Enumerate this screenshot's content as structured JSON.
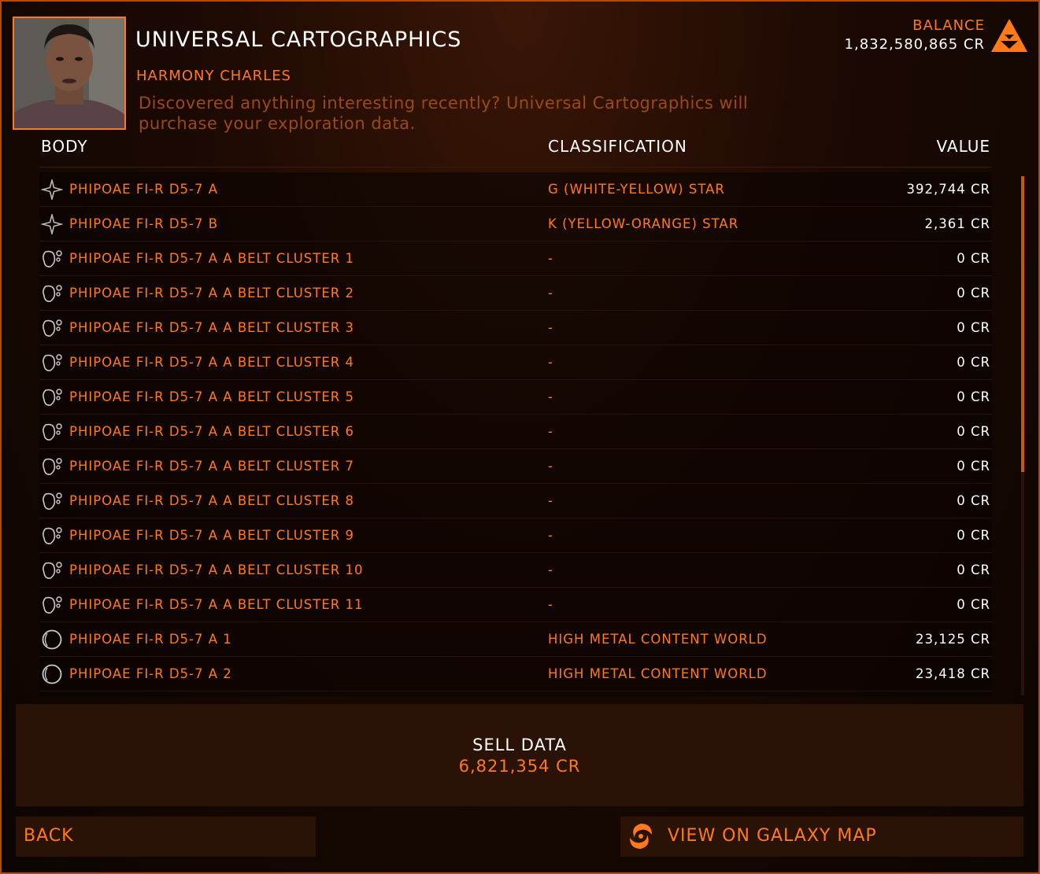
{
  "header": {
    "title": "UNIVERSAL CARTOGRAPHICS",
    "contact": "HARMONY CHARLES",
    "description": "Discovered anything interesting recently? Universal Cartographics will purchase your exploration data.",
    "balance_label": "BALANCE",
    "balance_value": "1,832,580,865 CR"
  },
  "columns": {
    "body": "BODY",
    "classification": "CLASSIFICATION",
    "value": "VALUE"
  },
  "rows": [
    {
      "icon": "star-icon",
      "body": "PHIPOAE FI-R D5-7 A",
      "classification": "G (WHITE-YELLOW) STAR",
      "value": "392,744 CR"
    },
    {
      "icon": "star-icon",
      "body": "PHIPOAE FI-R D5-7 B",
      "classification": "K (YELLOW-ORANGE) STAR",
      "value": "2,361 CR"
    },
    {
      "icon": "asteroid-icon",
      "body": "PHIPOAE FI-R D5-7 A A BELT CLUSTER 1",
      "classification": "-",
      "value": "0 CR"
    },
    {
      "icon": "asteroid-icon",
      "body": "PHIPOAE FI-R D5-7 A A BELT CLUSTER 2",
      "classification": "-",
      "value": "0 CR"
    },
    {
      "icon": "asteroid-icon",
      "body": "PHIPOAE FI-R D5-7 A A BELT CLUSTER 3",
      "classification": "-",
      "value": "0 CR"
    },
    {
      "icon": "asteroid-icon",
      "body": "PHIPOAE FI-R D5-7 A A BELT CLUSTER 4",
      "classification": "-",
      "value": "0 CR"
    },
    {
      "icon": "asteroid-icon",
      "body": "PHIPOAE FI-R D5-7 A A BELT CLUSTER 5",
      "classification": "-",
      "value": "0 CR"
    },
    {
      "icon": "asteroid-icon",
      "body": "PHIPOAE FI-R D5-7 A A BELT CLUSTER 6",
      "classification": "-",
      "value": "0 CR"
    },
    {
      "icon": "asteroid-icon",
      "body": "PHIPOAE FI-R D5-7 A A BELT CLUSTER 7",
      "classification": "-",
      "value": "0 CR"
    },
    {
      "icon": "asteroid-icon",
      "body": "PHIPOAE FI-R D5-7 A A BELT CLUSTER 8",
      "classification": "-",
      "value": "0 CR"
    },
    {
      "icon": "asteroid-icon",
      "body": "PHIPOAE FI-R D5-7 A A BELT CLUSTER 9",
      "classification": "-",
      "value": "0 CR"
    },
    {
      "icon": "asteroid-icon",
      "body": "PHIPOAE FI-R D5-7 A A BELT CLUSTER 10",
      "classification": "-",
      "value": "0 CR"
    },
    {
      "icon": "asteroid-icon",
      "body": "PHIPOAE FI-R D5-7 A A BELT CLUSTER 11",
      "classification": "-",
      "value": "0 CR"
    },
    {
      "icon": "planet-icon",
      "body": "PHIPOAE FI-R D5-7 A 1",
      "classification": "HIGH METAL CONTENT WORLD",
      "value": "23,125 CR"
    },
    {
      "icon": "planet-icon",
      "body": "PHIPOAE FI-R D5-7 A 2",
      "classification": "HIGH METAL CONTENT WORLD",
      "value": "23,418 CR"
    },
    {
      "icon": "planet-icon",
      "body": "",
      "classification": "",
      "value": ""
    }
  ],
  "scrollbar": {
    "position": 0,
    "visible_fraction": 0.57
  },
  "sell": {
    "label": "SELL DATA",
    "amount": "6,821,354 CR"
  },
  "buttons": {
    "back": "BACK",
    "galaxy_map": "VIEW ON GALAXY MAP"
  },
  "colors": {
    "accent": "#ff7a1a",
    "panel": "#2a1206",
    "text": "#ffffff"
  }
}
